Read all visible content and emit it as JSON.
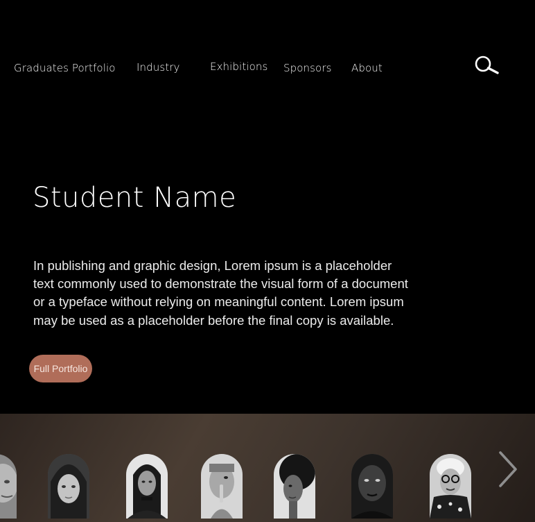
{
  "nav": {
    "items": [
      {
        "label": "Graduates Portfolio"
      },
      {
        "label": "Industry"
      },
      {
        "label": "Exhibitions"
      },
      {
        "label": "Sponsors"
      },
      {
        "label": "About"
      }
    ],
    "search_icon": "search-icon"
  },
  "hero": {
    "name": "Student Name",
    "bio": "In publishing and graphic design, Lorem ipsum is a placeholder text commonly used to demonstrate the visual form of a document or a typeface without relying on meaningful content. Lorem ipsum may be used as a placeholder before the final copy is available.",
    "button_label": "Full Portfolio"
  },
  "gallery": {
    "portrait_count": 7,
    "next_icon": "chevron-right-icon"
  },
  "colors": {
    "background": "#000000",
    "accent": "#b06d59",
    "strip": "#3d332c"
  }
}
